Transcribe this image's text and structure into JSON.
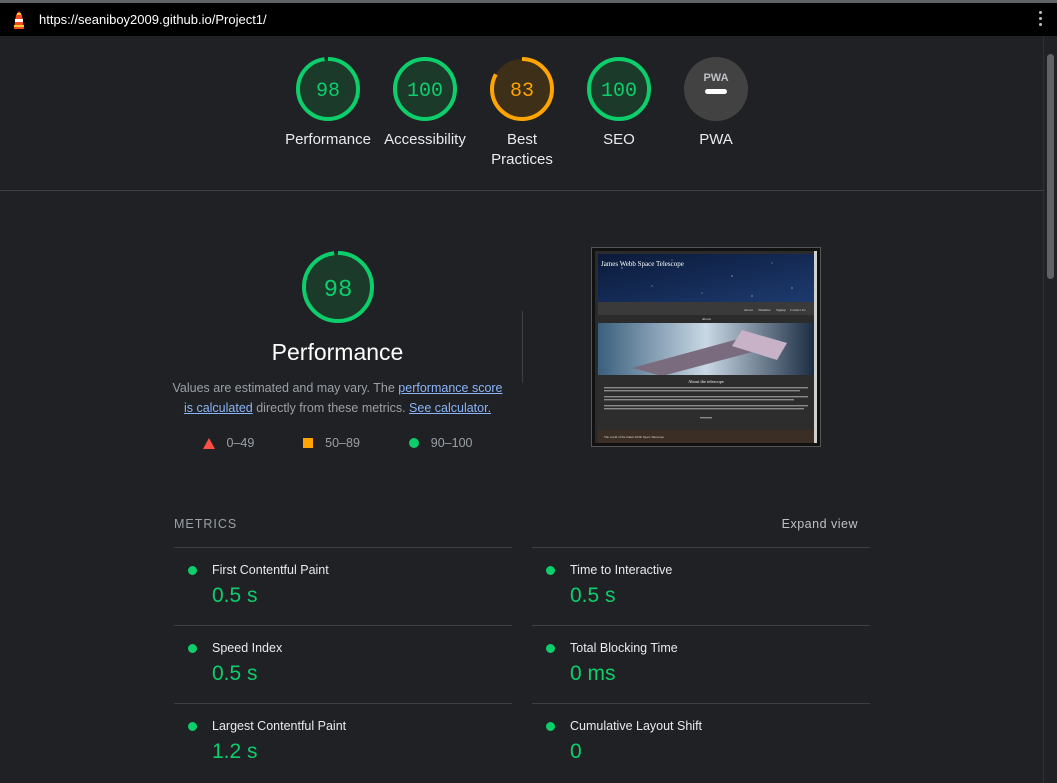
{
  "browser": {
    "url": "https://seaniboy2009.github.io/Project1/"
  },
  "colors": {
    "pass": "#0cce6b",
    "average": "#ffa400",
    "fail": "#ff4e42",
    "accent_link": "#8ab4f8"
  },
  "gauges": [
    {
      "label": "Performance",
      "score": "98",
      "status": "pass"
    },
    {
      "label": "Accessibility",
      "score": "100",
      "status": "pass"
    },
    {
      "label": "Best Practices",
      "score": "83",
      "status": "average"
    },
    {
      "label": "SEO",
      "score": "100",
      "status": "pass"
    },
    {
      "label": "PWA",
      "score": "",
      "badge": "PWA",
      "status": "na"
    }
  ],
  "performance": {
    "score": "98",
    "title": "Performance",
    "desc_prefix": "Values are estimated and may vary. The ",
    "link1": "performance score is calculated",
    "desc_middle": " directly from these metrics. ",
    "link2": "See calculator.",
    "legend": [
      {
        "range": "0–49",
        "shape": "triangle"
      },
      {
        "range": "50–89",
        "shape": "square"
      },
      {
        "range": "90–100",
        "shape": "circle"
      }
    ]
  },
  "screenshot": {
    "site_title": "James Webb Space Telescope",
    "nav": [
      "About",
      "Timeline",
      "Signup",
      "Contact Us"
    ],
    "section": "About",
    "heading": "About the telescope",
    "footer_text": "The world of the James Webb Space Telescope"
  },
  "metrics": {
    "header": "METRICS",
    "expand": "Expand view",
    "items": [
      {
        "name": "First Contentful Paint",
        "value": "0.5 s"
      },
      {
        "name": "Time to Interactive",
        "value": "0.5 s"
      },
      {
        "name": "Speed Index",
        "value": "0.5 s"
      },
      {
        "name": "Total Blocking Time",
        "value": "0 ms"
      },
      {
        "name": "Largest Contentful Paint",
        "value": "1.2 s"
      },
      {
        "name": "Cumulative Layout Shift",
        "value": "0"
      }
    ]
  }
}
